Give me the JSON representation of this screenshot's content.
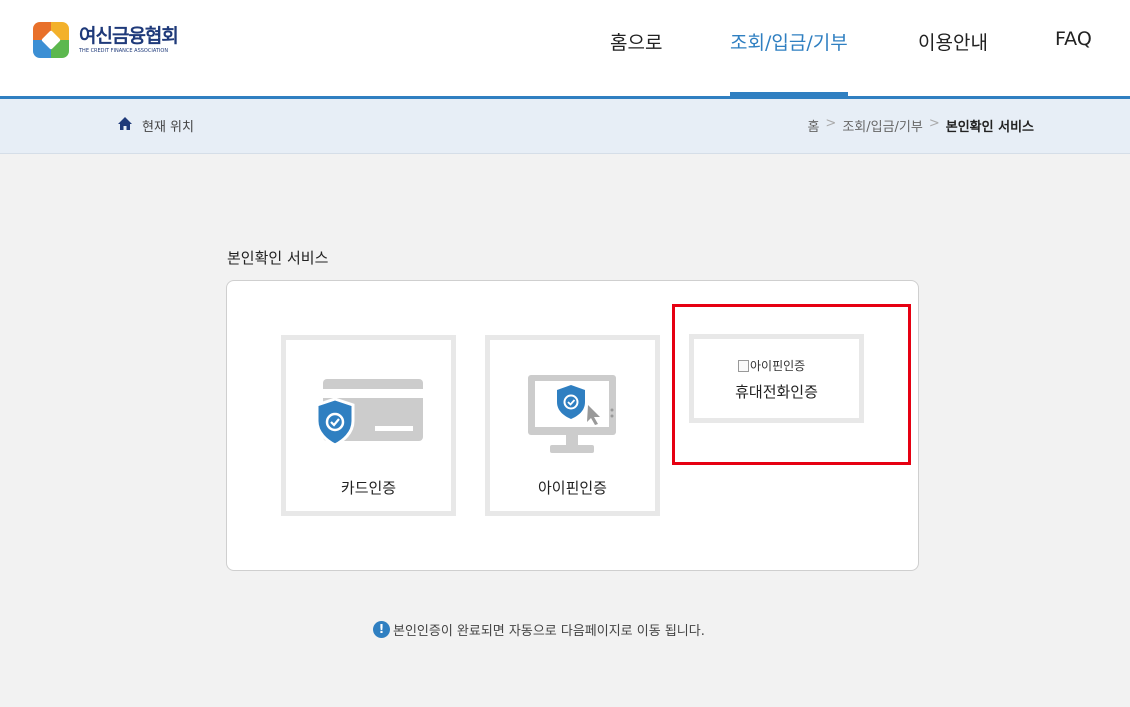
{
  "logo": {
    "name_ko": "여신금융협회",
    "name_en": "THE CREDIT FINANCE ASSOCIATION"
  },
  "nav": {
    "items": [
      {
        "label": "홈으로"
      },
      {
        "label": "조회/입금/기부"
      },
      {
        "label": "이용안내"
      },
      {
        "label": "FAQ"
      }
    ],
    "active_index": 1
  },
  "breadcrumb": {
    "location_label": "현재 위치",
    "path": [
      "홈",
      "조회/입금/기부",
      "본인확인 서비스"
    ],
    "separator": ">"
  },
  "main": {
    "section_title": "본인확인 서비스",
    "cards": [
      {
        "label": "카드인증",
        "icon": "credit-card-shield-icon"
      },
      {
        "label": "아이핀인증",
        "icon": "monitor-shield-cursor-icon"
      },
      {
        "label": "휴대전화인증",
        "image_alt": "아이핀인증",
        "icon": "broken-image-icon"
      }
    ],
    "notice": "본인인증이 완료되면 자동으로 다음페이지로 이동 됩니다."
  },
  "colors": {
    "accent": "#2f7fc1",
    "highlight_border": "#e60012",
    "background": "#f2f2f2",
    "breadcrumb_bg": "#e7eef6"
  }
}
